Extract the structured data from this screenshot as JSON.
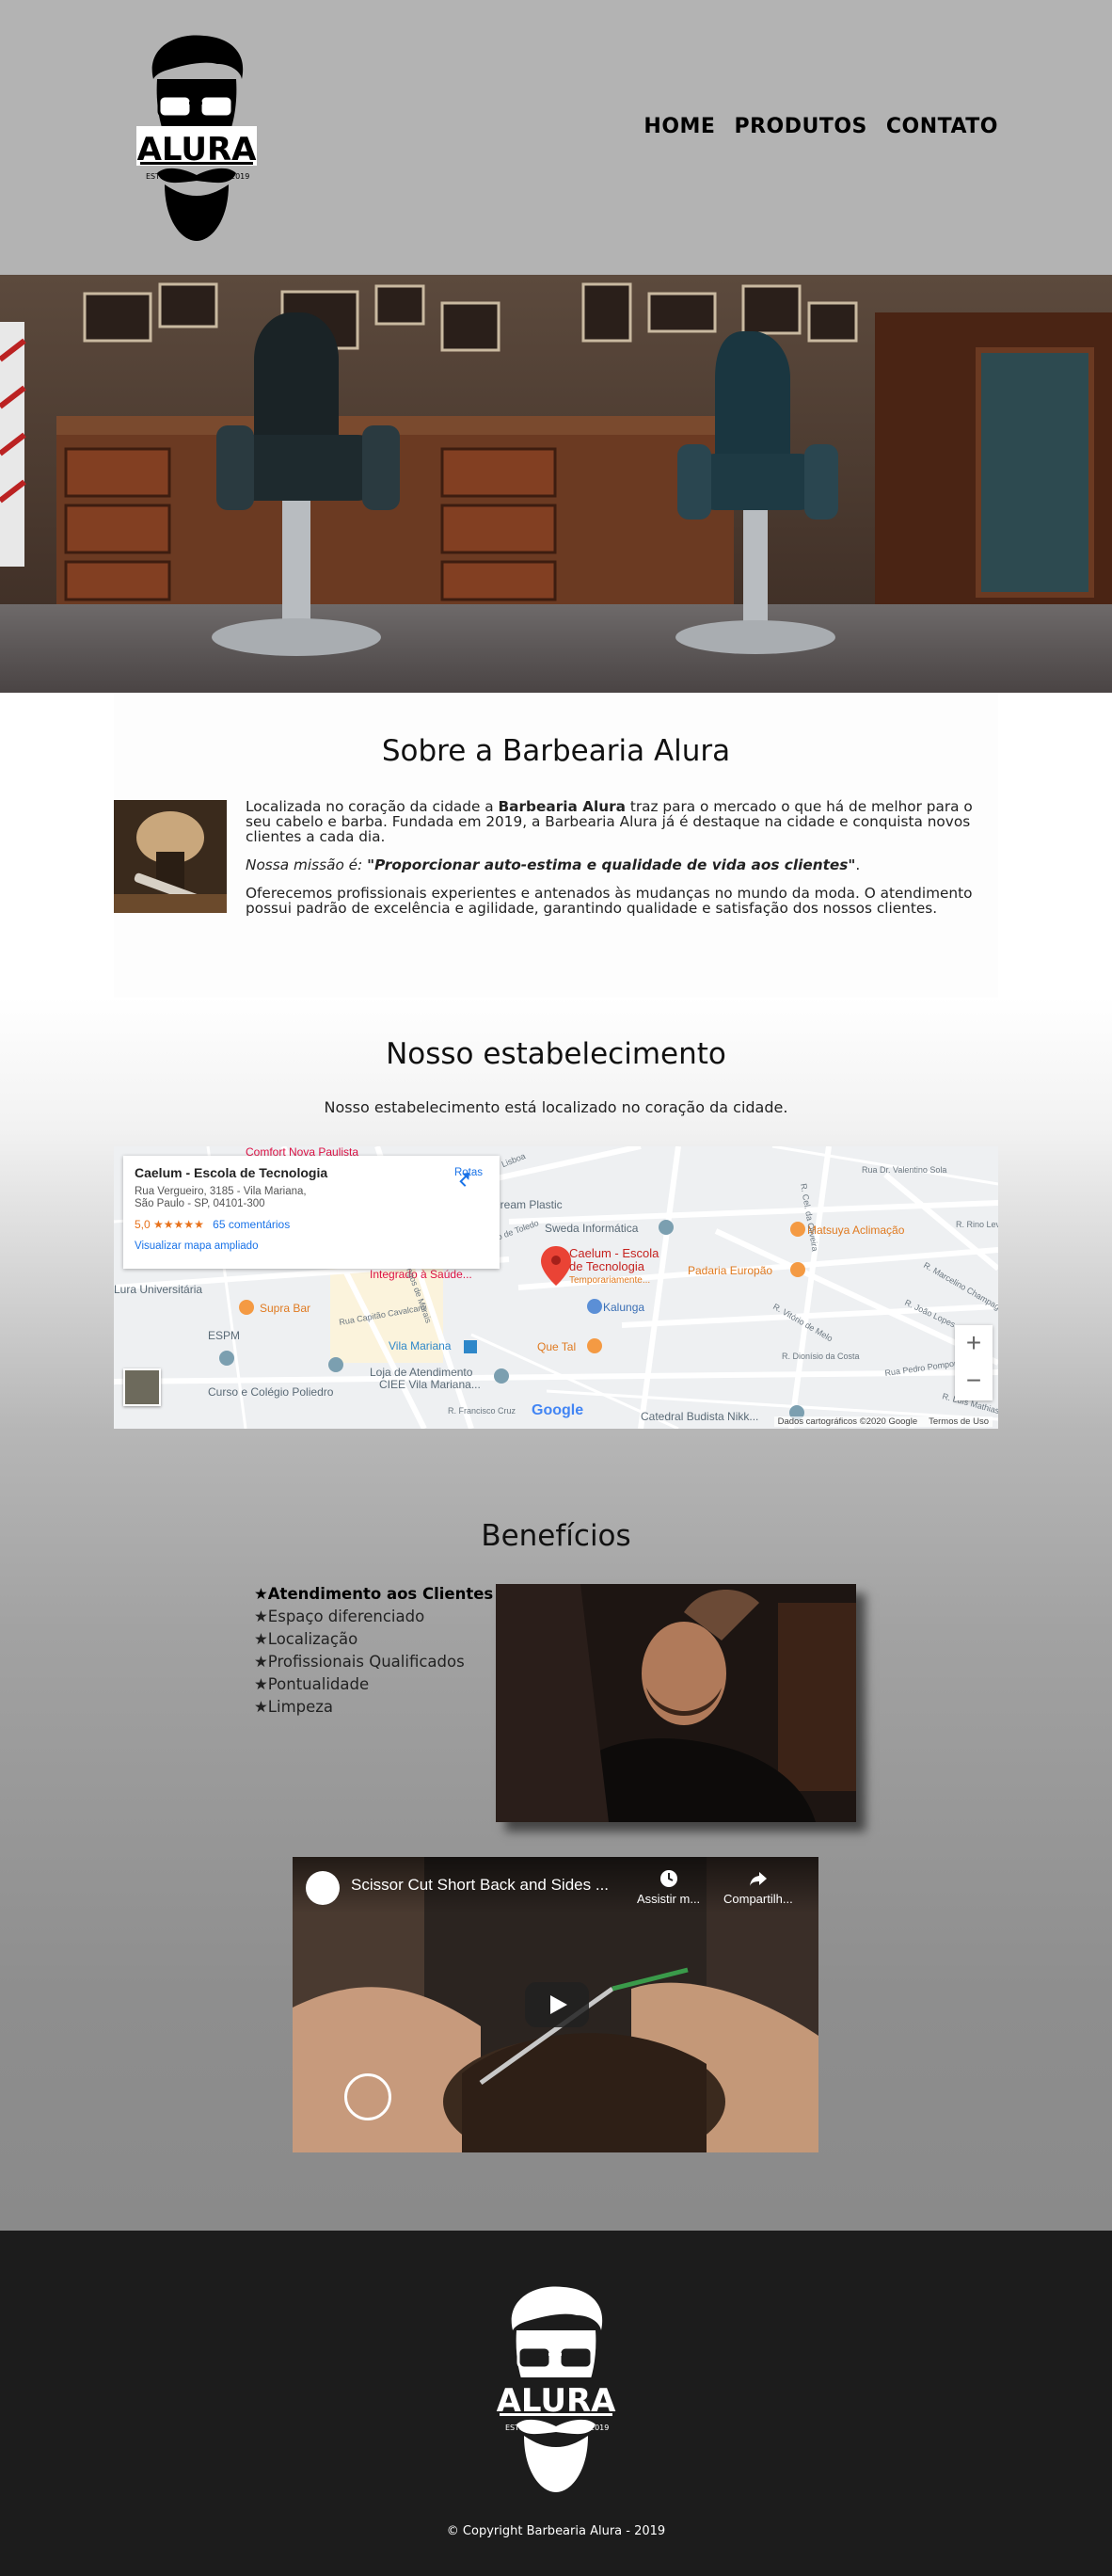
{
  "header": {
    "logo": {
      "brand": "ALURA",
      "estd_label": "ESTD",
      "year": "2019"
    },
    "nav": [
      {
        "label": "HOME"
      },
      {
        "label": "PRODUTOS"
      },
      {
        "label": "CONTATO"
      }
    ]
  },
  "about": {
    "title": "Sobre a Barbearia Alura",
    "p1_before": "Localizada no coração da cidade a ",
    "p1_bold": "Barbearia Alura",
    "p1_after": " traz para o mercado o que há de melhor para o seu cabelo e barba. Fundada em 2019, a Barbearia Alura já é destaque na cidade e conquista novos clientes a cada dia.",
    "mission_label": "Nossa missão é: ",
    "mission_text": "\"Proporcionar auto-estima e qualidade de vida aos clientes\"",
    "mission_end": ".",
    "p3": "Oferecemos profissionais experientes e antenados às mudanças no mundo da moda. O atendimento possui padrão de excelência e agilidade, garantindo qualidade e satisfação dos nossos clientes."
  },
  "establishment": {
    "title": "Nosso estabelecimento",
    "subtitle": "Nosso estabelecimento está localizado no coração da cidade.",
    "map": {
      "place_name": "Caelum - Escola de Tecnologia",
      "address_line1": "Rua Vergueiro, 3185 - Vila Mariana,",
      "address_line2": "São Paulo - SP, 04101-300",
      "rating": "5,0",
      "stars": "★★★★★",
      "reviews": "65 comentários",
      "directions": "Rotas",
      "larger_map": "Visualizar mapa ampliado",
      "zoom_in": "+",
      "zoom_out": "−",
      "credit": "Dados cartográficos ©2020 Google",
      "terms": "Termos de Uso",
      "google": "Google",
      "labels": {
        "marker_name1": "Caelum - Escola",
        "marker_name2": "de Tecnologia",
        "marker_sub": "Temporariamente...",
        "dream_plastic": "Dream Plastic",
        "sweda": "Sweda Informática",
        "matsuya": "Matsuya Aclimação",
        "padaria": "Padaria Europão",
        "kalunga": "Kalunga",
        "que_tal": "Que Tal",
        "supra_bar": "Supra Bar",
        "univ": "Lura Universitária",
        "espm": "ESPM",
        "integrado": "Integrado à Saúde...",
        "vila_mariana": "Vila Mariana",
        "curso": "Curso e Colégio Poliedro",
        "loja1": "Loja de Atendimento",
        "loja2": "CIEE Vila Mariana...",
        "catedral": "Catedral Budista Nikk...",
        "comfort": "Comfort Nova Paulista",
        "r_baltazar": "R. Baltazar Lisboa",
        "r_domingos": "R. Domingos de Morais",
        "r_pedro": "R. Pedro de Toledo",
        "r_capitao": "Rua Capitão Cavalcanti",
        "r_francisco": "R. Francisco Cruz",
        "r_vitorio": "R. Vitório de Melo",
        "r_dionisio": "R. Dionísio da Costa",
        "r_joao": "R. João Lopes",
        "r_marcelino": "R. Marcelino Champagnat",
        "r_rino": "R. Rino Levi",
        "r_valentino": "Rua Dr. Valentino Sola",
        "r_luis": "R. Luís Mathias",
        "r_pedro_pomp": "Rua Pedro Pomponazzi",
        "r_cel": "R. Cel. da Oliveira"
      }
    }
  },
  "benefits": {
    "title": "Benefícios",
    "items": [
      "★Atendimento aos Clientes",
      "★Espaço diferenciado",
      "★Localização",
      "★Profissionais Qualificados",
      "★Pontualidade",
      "★Limpeza"
    ],
    "video": {
      "title": "Scissor Cut Short Back and Sides ...",
      "watch_later": "Assistir m...",
      "share": "Compartilh..."
    }
  },
  "footer": {
    "copyright": "© Copyright Barbearia Alura - 2019"
  },
  "colors": {
    "header_bg": "#b3b3b3",
    "footer_bg": "#1c1c1c",
    "map_link": "#1a73e8",
    "map_marker": "#ea4335"
  }
}
